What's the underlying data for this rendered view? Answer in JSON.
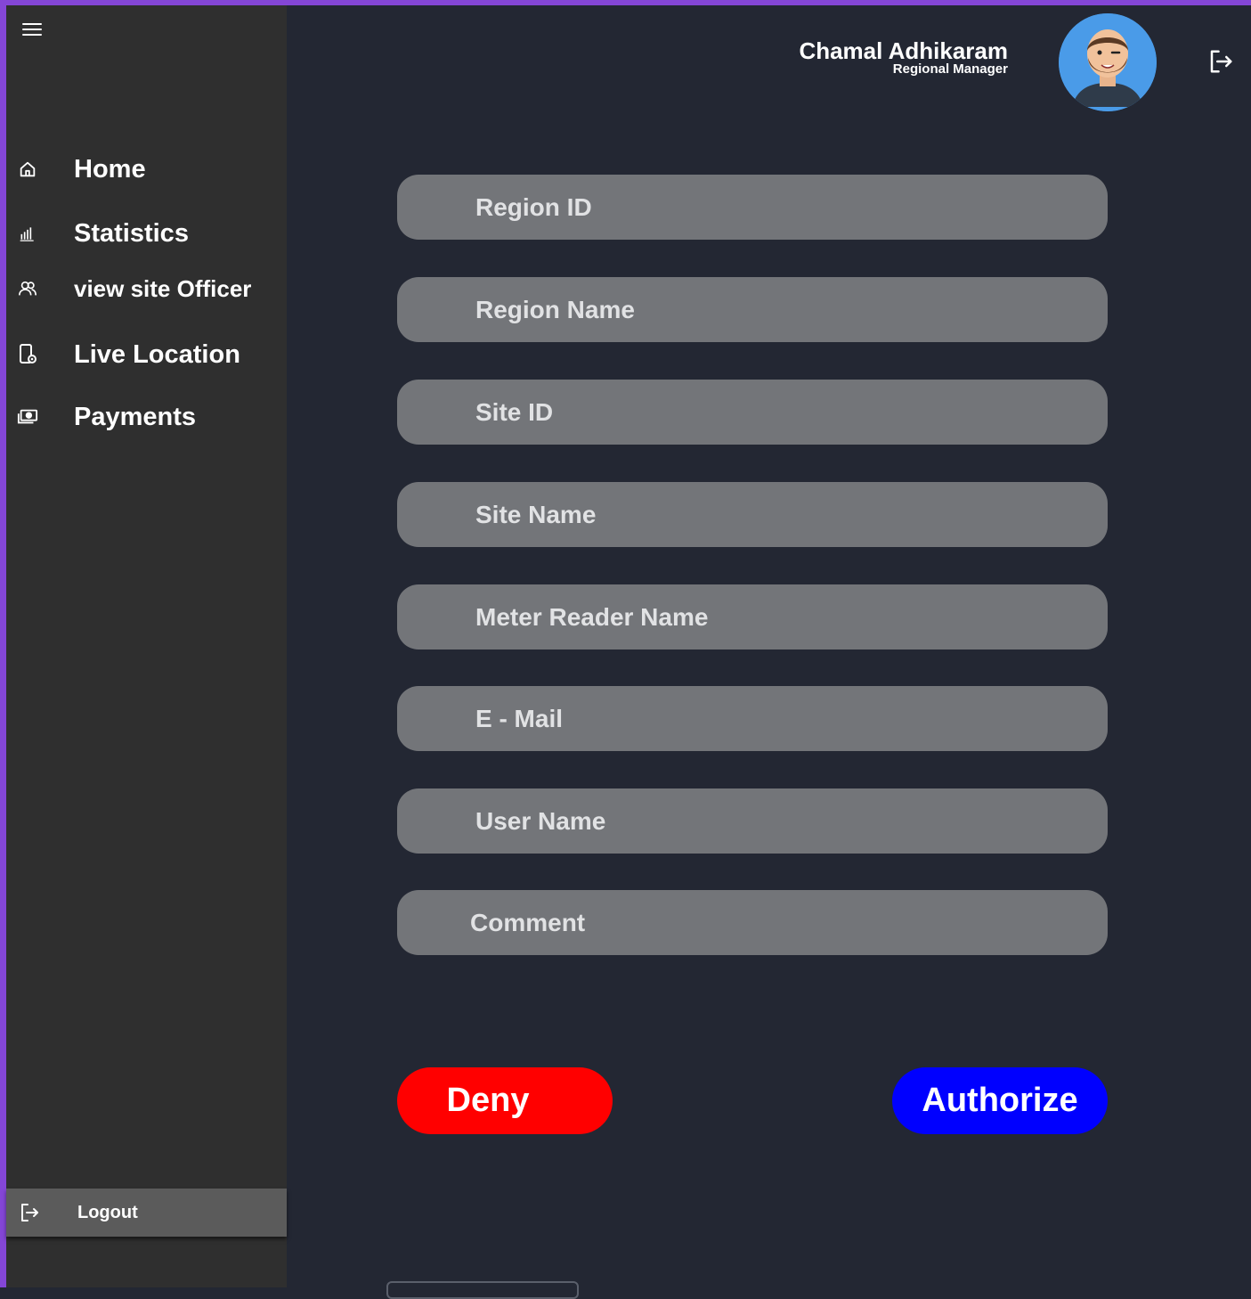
{
  "user": {
    "name": "Chamal Adhikaram",
    "role": "Regional Manager"
  },
  "sidebar": {
    "items": [
      {
        "label": "Home",
        "icon": "home-icon"
      },
      {
        "label": "Statistics",
        "icon": "bar-chart-icon"
      },
      {
        "label": "view site Officer",
        "icon": "users-icon"
      },
      {
        "label": "Live Location",
        "icon": "phone-location-icon"
      },
      {
        "label": "Payments",
        "icon": "money-icon"
      }
    ],
    "logout_label": "Logout"
  },
  "form": {
    "fields": [
      {
        "placeholder": "Region ID"
      },
      {
        "placeholder": "Region Name"
      },
      {
        "placeholder": "Site ID"
      },
      {
        "placeholder": "Site Name"
      },
      {
        "placeholder": "Meter Reader Name"
      },
      {
        "placeholder": "E - Mail"
      },
      {
        "placeholder": "User Name"
      },
      {
        "placeholder": "Comment"
      }
    ],
    "deny_label": "Deny",
    "authorize_label": "Authorize"
  },
  "colors": {
    "background": "#232733",
    "sidebar": "#2f2f2f",
    "field": "#737579",
    "deny": "#ff0000",
    "authorize": "#0000ff",
    "frame": "#8446d6"
  }
}
